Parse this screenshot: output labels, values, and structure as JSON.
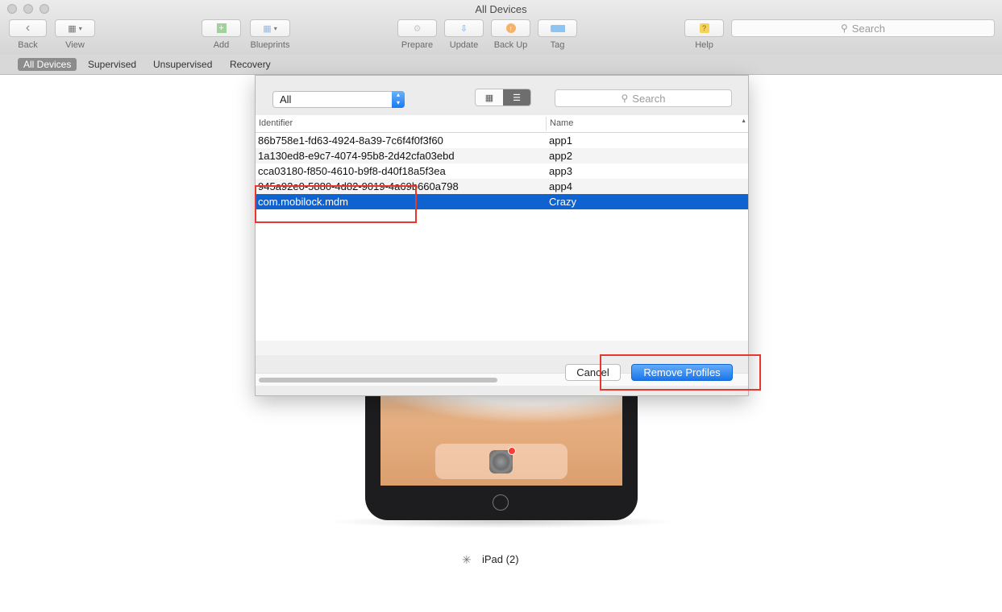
{
  "window": {
    "title": "All Devices"
  },
  "toolbar": {
    "back_label": "Back",
    "view_label": "View",
    "add_label": "Add",
    "blueprints_label": "Blueprints",
    "prepare_label": "Prepare",
    "update_label": "Update",
    "backup_label": "Back Up",
    "tag_label": "Tag",
    "help_label": "Help",
    "search_placeholder": "Search"
  },
  "scopes": [
    "All Devices",
    "Supervised",
    "Unsupervised",
    "Recovery"
  ],
  "active_scope": "All Devices",
  "dialog": {
    "filter_value": "All",
    "search_placeholder": "Search",
    "columns": [
      "Identifier",
      "Name"
    ],
    "rows": [
      {
        "identifier": "86b758e1-fd63-4924-8a39-7c6f4f0f3f60",
        "name": "app1"
      },
      {
        "identifier": "1a130ed8-e9c7-4074-95b8-2d42cfa03ebd",
        "name": "app2"
      },
      {
        "identifier": "cca03180-f850-4610-b9f8-d40f18a5f3ea",
        "name": "app3"
      },
      {
        "identifier": "945a92e0-5880-4d82-9019-4a69b660a798",
        "name": "app4"
      },
      {
        "identifier": "com.mobilock.mdm",
        "name": "Crazy"
      }
    ],
    "selected_row": 4,
    "cancel_label": "Cancel",
    "remove_label": "Remove Profiles"
  },
  "device": {
    "label": "iPad (2)"
  },
  "colors": {
    "accent": "#1b76ec",
    "selection": "#0e63d0",
    "highlight": "#e8372c"
  }
}
